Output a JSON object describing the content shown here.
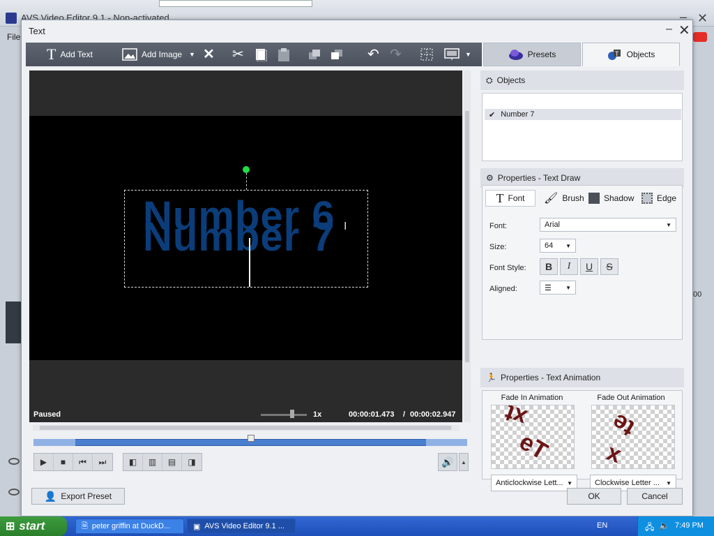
{
  "background_app": {
    "title": "AVS Video Editor 9.1 - Non-activated",
    "menu_file": "File",
    "right_time": "00"
  },
  "dialog": {
    "title": "Text",
    "toolbar": {
      "add_text": "Add Text",
      "add_image": "Add Image"
    },
    "side_tabs": {
      "presets": "Presets",
      "objects": "Objects"
    },
    "preview": {
      "line1": "Number 6",
      "line2": "Number 7",
      "status": "Paused",
      "speed": "1x",
      "current_time": "00:00:01.473",
      "separator": "/",
      "total_time": "00:00:02.947"
    },
    "objects_panel": {
      "header": "Objects",
      "items": [
        {
          "label": "Number 7",
          "checked": true
        }
      ]
    },
    "properties_panel": {
      "header": "Properties - Text Draw",
      "subtabs": [
        "Font",
        "Brush",
        "Shadow",
        "Edge"
      ],
      "font_label": "Font:",
      "font_value": "Arial",
      "size_label": "Size:",
      "size_value": "64",
      "style_label": "Font Style:",
      "aligned_label": "Aligned:"
    },
    "animation_panel": {
      "header": "Properties - Text Animation",
      "fade_in_label": "Fade In Animation",
      "fade_out_label": "Fade Out Animation",
      "fade_in_value": "Anticlockwise Lett...",
      "fade_out_value": "Clockwise Letter ..."
    },
    "buttons": {
      "export_preset": "Export Preset",
      "ok": "OK",
      "cancel": "Cancel"
    }
  },
  "taskbar": {
    "start": "start",
    "items": [
      {
        "label": "peter griffin at DuckD..."
      },
      {
        "label": "AVS Video Editor 9.1 ..."
      }
    ],
    "language": "EN",
    "clock": "7:49 PM"
  },
  "colors": {
    "text_blue": "#0b3d7a",
    "timeline_blue": "#4a7fd0",
    "rotate_handle": "#22dd44"
  }
}
